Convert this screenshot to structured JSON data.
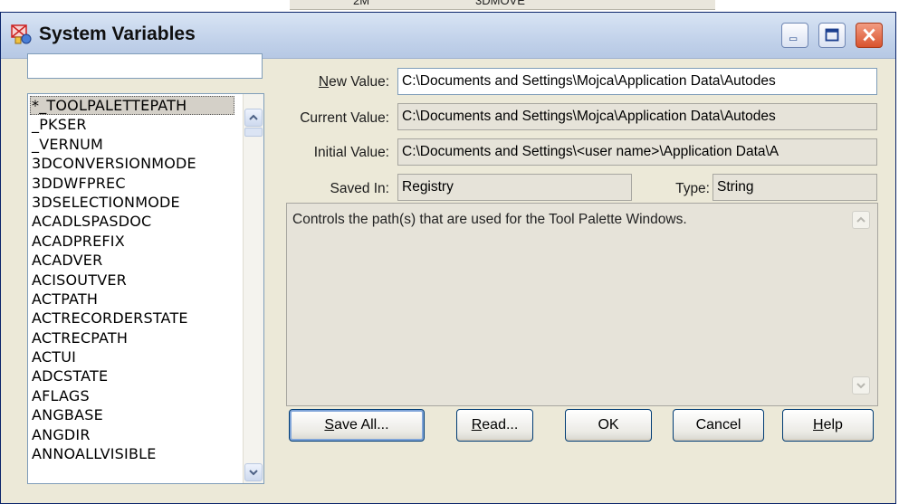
{
  "background": {
    "cell_left": "2M",
    "cell_right": "3DMOVE"
  },
  "window": {
    "title": "System Variables",
    "title_icon": "autocad-sysvar-icon",
    "minimize_icon": "minimize-icon",
    "maximize_icon": "maximize-icon",
    "close_icon": "close-icon"
  },
  "search": {
    "value": "",
    "placeholder": ""
  },
  "variables": {
    "items": [
      "*_TOOLPALETTEPATH",
      "_PKSER",
      "_VERNUM",
      "3DCONVERSIONMODE",
      "3DDWFPREC",
      "3DSELECTIONMODE",
      "ACADLSPASDOC",
      "ACADPREFIX",
      "ACADVER",
      "ACISOUTVER",
      "ACTPATH",
      "ACTRECORDERSTATE",
      "ACTRECPATH",
      "ACTUI",
      "ADCSTATE",
      "AFLAGS",
      "ANGBASE",
      "ANGDIR",
      "ANNOALLVISIBLE"
    ],
    "selected_index": 0
  },
  "fields": {
    "new_value": {
      "label_prefix": "",
      "label_mnemonic": "N",
      "label_rest": "ew Value:",
      "value": "C:\\Documents and Settings\\Mojca\\Application Data\\Autodes"
    },
    "current_value": {
      "label": "Current Value:",
      "value": "C:\\Documents and Settings\\Mojca\\Application Data\\Autodes"
    },
    "initial_value": {
      "label": "Initial Value:",
      "value": "C:\\Documents and Settings\\<user name>\\Application Data\\A"
    },
    "saved_in": {
      "label": "Saved In:",
      "value": "Registry"
    },
    "type": {
      "label": "Type:",
      "value": "String"
    }
  },
  "description": "Controls the path(s) that are used for the Tool Palette Windows.",
  "buttons": {
    "save_all": {
      "mnemonic": "S",
      "rest": "ave All..."
    },
    "read": {
      "mnemonic": "R",
      "rest": "ead..."
    },
    "ok": "OK",
    "cancel": "Cancel",
    "help": {
      "mnemonic": "H",
      "rest": "elp"
    }
  }
}
